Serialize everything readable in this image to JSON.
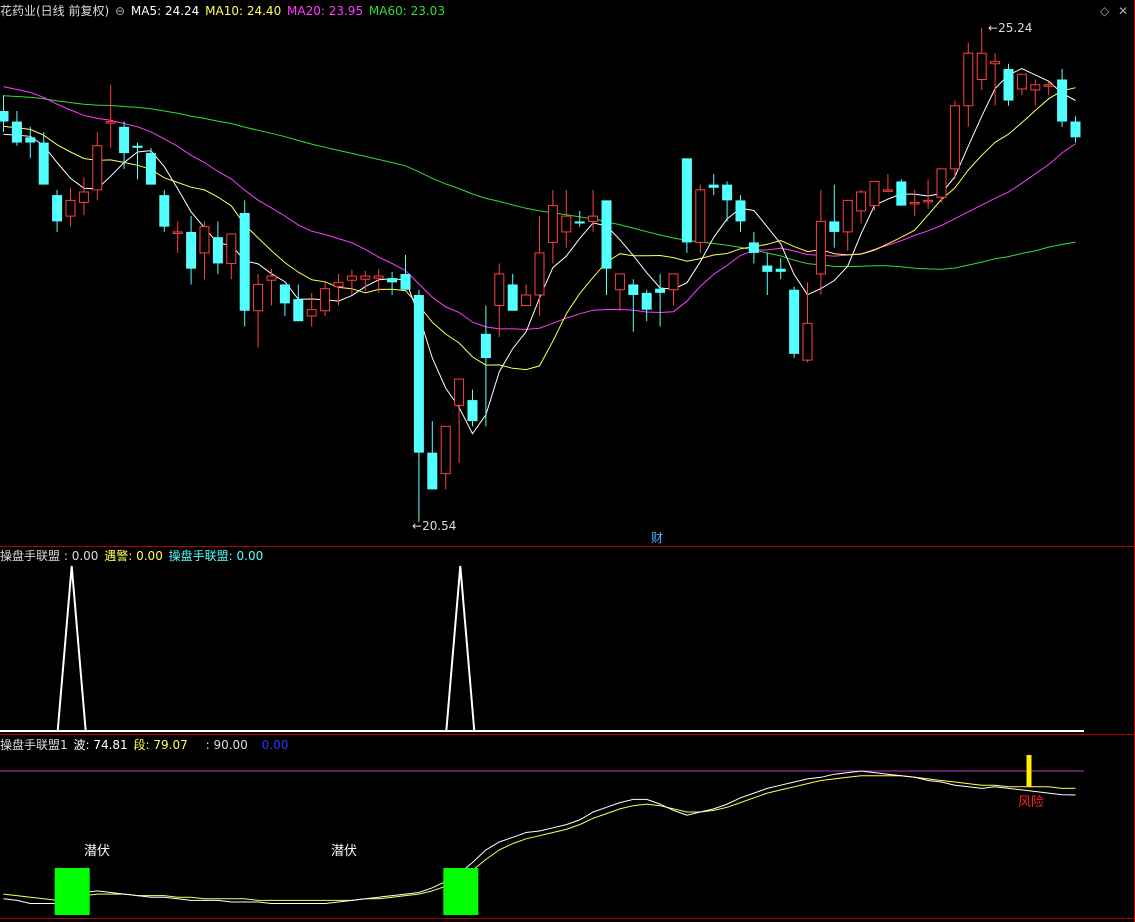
{
  "colors": {
    "up": "#ff4040",
    "down": "#54ffff",
    "ma5": "#ffffff",
    "ma10": "#ffff55",
    "ma20": "#ff3cff",
    "ma60": "#33dd33",
    "divider": "#b00000",
    "hline": "#c030c0",
    "green_box": "#00ff00",
    "yellow_bar": "#ffee00",
    "risk_text": "#ff2020"
  },
  "header": {
    "title": "花药业(日线 前复权)",
    "collapse_icon": "circle-minus-icon",
    "ma5": "MA5: 24.24",
    "ma10": "MA10: 24.40",
    "ma20": "MA20: 23.95",
    "ma60": "MA60: 23.03",
    "diamond_icon": "diamond-icon",
    "close_icon": "close-icon"
  },
  "indicator1": {
    "name1": "操盘手联盟",
    "val1": " : 0.00",
    "name2": "遇警",
    "val2": ": 0.00",
    "name3": "操盘手联盟",
    "val3": ": 0.00"
  },
  "indicator2": {
    "name": "操盘手联盟1",
    "bo_label": "波",
    "bo_val": ": 74.81",
    "duan_label": "段",
    "duan_val": ": 79.07",
    "line_val": ": 90.00",
    "blue_val": "0.00"
  },
  "annotations": {
    "high_price": "25.24",
    "low_price": "20.54",
    "cai_marker": "财",
    "ambush1": "潜伏",
    "ambush2": "潜伏",
    "risk": "风险"
  },
  "chart_data": [
    {
      "type": "candlestick",
      "title": "花药业(日线 前复权)",
      "ylim": [
        20.54,
        25.24
      ],
      "moving_averages": {
        "MA5": 24.24,
        "MA10": 24.4,
        "MA20": 23.95,
        "MA60": 23.03
      },
      "candles": [
        [
          24.45,
          24.6,
          24.25,
          24.35
        ],
        [
          24.35,
          24.45,
          24.12,
          24.15
        ],
        [
          24.2,
          24.3,
          24.0,
          24.15
        ],
        [
          24.15,
          24.25,
          23.8,
          23.75
        ],
        [
          23.65,
          23.7,
          23.3,
          23.4
        ],
        [
          23.45,
          23.72,
          23.35,
          23.6
        ],
        [
          23.58,
          23.82,
          23.46,
          23.68
        ],
        [
          23.7,
          24.25,
          23.6,
          24.12
        ],
        [
          24.35,
          24.7,
          24.1,
          24.35
        ],
        [
          24.3,
          24.35,
          23.9,
          24.05
        ],
        [
          24.12,
          24.15,
          23.8,
          24.1
        ],
        [
          24.05,
          24.1,
          23.85,
          23.75
        ],
        [
          23.65,
          23.7,
          23.3,
          23.35
        ],
        [
          23.3,
          23.4,
          23.1,
          23.3
        ],
        [
          23.3,
          23.45,
          22.8,
          22.95
        ],
        [
          23.1,
          23.4,
          22.85,
          23.35
        ],
        [
          23.25,
          23.4,
          22.9,
          23.0
        ],
        [
          23.0,
          23.2,
          22.85,
          23.28
        ],
        [
          23.48,
          23.6,
          22.4,
          22.55
        ],
        [
          22.55,
          22.9,
          22.2,
          22.8
        ],
        [
          22.84,
          22.95,
          22.6,
          22.88
        ],
        [
          22.8,
          22.8,
          22.5,
          22.62
        ],
        [
          22.66,
          22.8,
          22.45,
          22.45
        ],
        [
          22.5,
          22.72,
          22.4,
          22.56
        ],
        [
          22.55,
          22.82,
          22.5,
          22.76
        ],
        [
          22.78,
          22.9,
          22.6,
          22.82
        ],
        [
          22.84,
          22.94,
          22.7,
          22.88
        ],
        [
          22.85,
          22.93,
          22.74,
          22.88
        ],
        [
          22.86,
          22.95,
          22.72,
          22.88
        ],
        [
          22.86,
          22.92,
          22.7,
          22.82
        ],
        [
          22.9,
          23.08,
          22.75,
          22.75
        ],
        [
          22.7,
          22.75,
          20.54,
          21.2
        ],
        [
          21.2,
          21.5,
          20.85,
          20.85
        ],
        [
          21.0,
          21.4,
          20.85,
          21.45
        ],
        [
          21.65,
          21.8,
          21.1,
          21.9
        ],
        [
          21.7,
          21.8,
          21.45,
          21.5
        ],
        [
          22.33,
          22.6,
          21.45,
          22.1
        ],
        [
          22.6,
          23.0,
          22.3,
          22.9
        ],
        [
          22.8,
          22.9,
          22.55,
          22.55
        ],
        [
          22.6,
          22.8,
          22.6,
          22.7
        ],
        [
          22.7,
          23.45,
          22.5,
          23.1
        ],
        [
          23.2,
          23.7,
          23.0,
          23.55
        ],
        [
          23.3,
          23.7,
          23.15,
          23.45
        ],
        [
          23.4,
          23.5,
          23.35,
          23.38
        ],
        [
          23.4,
          23.7,
          23.3,
          23.45
        ],
        [
          23.6,
          23.6,
          22.7,
          22.95
        ],
        [
          22.75,
          22.85,
          22.55,
          22.9
        ],
        [
          22.8,
          22.85,
          22.35,
          22.7
        ],
        [
          22.72,
          22.75,
          22.45,
          22.56
        ],
        [
          22.76,
          22.9,
          22.4,
          22.72
        ],
        [
          22.75,
          22.8,
          22.6,
          22.9
        ],
        [
          24.0,
          24.0,
          23.1,
          23.2
        ],
        [
          23.2,
          23.75,
          23.1,
          23.7
        ],
        [
          23.75,
          23.85,
          23.65,
          23.72
        ],
        [
          23.75,
          23.78,
          23.4,
          23.6
        ],
        [
          23.6,
          23.65,
          23.3,
          23.4
        ],
        [
          23.2,
          23.3,
          23.0,
          23.1
        ],
        [
          22.98,
          23.1,
          22.7,
          22.92
        ],
        [
          22.95,
          23.05,
          22.85,
          22.92
        ],
        [
          22.75,
          22.78,
          22.1,
          22.14
        ],
        [
          22.08,
          22.82,
          22.06,
          22.43
        ],
        [
          22.9,
          23.7,
          22.7,
          23.4
        ],
        [
          23.4,
          23.75,
          23.15,
          23.3
        ],
        [
          23.3,
          23.6,
          23.12,
          23.6
        ],
        [
          23.5,
          23.7,
          23.38,
          23.68
        ],
        [
          23.55,
          23.7,
          23.5,
          23.78
        ],
        [
          23.7,
          23.85,
          23.68,
          23.7
        ],
        [
          23.78,
          23.8,
          23.55,
          23.55
        ],
        [
          23.58,
          23.7,
          23.45,
          23.58
        ],
        [
          23.6,
          23.8,
          23.52,
          23.6
        ],
        [
          23.63,
          23.9,
          23.58,
          23.9
        ],
        [
          23.9,
          24.55,
          23.8,
          24.5
        ],
        [
          24.5,
          25.1,
          24.3,
          25.0
        ],
        [
          24.75,
          25.24,
          24.65,
          25.0
        ],
        [
          24.9,
          25.0,
          24.5,
          24.92
        ],
        [
          24.85,
          24.9,
          24.5,
          24.55
        ],
        [
          24.66,
          24.8,
          24.6,
          24.8
        ],
        [
          24.65,
          24.75,
          24.5,
          24.7
        ],
        [
          24.7,
          24.73,
          24.6,
          24.7
        ],
        [
          24.75,
          24.85,
          24.3,
          24.35
        ],
        [
          24.35,
          24.4,
          24.15,
          24.2
        ]
      ]
    },
    {
      "type": "line",
      "title": "操盘手联盟",
      "series": [
        {
          "name": "操盘手联盟",
          "values": [
            0,
            0,
            0,
            1,
            0,
            0,
            0,
            0,
            0,
            0,
            0,
            0,
            0,
            0,
            0,
            0,
            0,
            0,
            0,
            0,
            0,
            0,
            0,
            0,
            0,
            0,
            0,
            0,
            0,
            0,
            0,
            0,
            1,
            0,
            0,
            0,
            0,
            0,
            0,
            0,
            0,
            0,
            0,
            0,
            0,
            0,
            0,
            0,
            0,
            0,
            0,
            0,
            0,
            0,
            0,
            0,
            0,
            0,
            0,
            0,
            0,
            0,
            0,
            0,
            0,
            0,
            0,
            0,
            0,
            0,
            0,
            0,
            0,
            0,
            0,
            0,
            0,
            0,
            0,
            0,
            0
          ]
        },
        {
          "name": "遇警",
          "values": [
            0,
            0,
            0,
            0,
            0,
            0,
            0,
            0,
            0,
            0,
            0,
            0,
            0,
            0,
            0,
            0,
            0,
            0,
            0,
            0,
            0,
            0,
            0,
            0,
            0,
            0,
            0,
            0,
            0,
            0,
            0,
            0,
            0,
            0,
            0,
            0,
            0,
            0,
            0,
            0,
            0,
            0,
            0,
            0,
            0,
            0,
            0,
            0,
            0,
            0,
            0,
            0,
            0,
            0,
            0,
            0,
            0,
            0,
            0,
            0,
            0,
            0,
            0,
            0,
            0,
            0,
            0,
            0,
            0,
            0,
            0,
            0,
            0,
            0,
            0,
            0,
            0,
            0,
            0,
            0,
            0
          ]
        }
      ]
    },
    {
      "type": "line",
      "title": "操盘手联盟1",
      "ylim": [
        0,
        100
      ],
      "hline": 90,
      "series": [
        {
          "name": "波",
          "values": [
            9,
            8,
            6,
            6,
            6,
            10,
            13,
            14,
            13,
            12,
            11,
            10,
            10,
            9,
            8,
            8,
            8,
            7,
            7,
            7,
            6,
            6,
            6,
            6,
            6,
            7,
            8,
            9,
            10,
            11,
            12,
            13,
            16,
            20,
            25,
            32,
            40,
            45,
            48,
            51,
            52,
            54,
            56,
            59,
            64,
            67,
            70,
            72,
            72,
            69,
            65,
            62,
            64,
            66,
            69,
            73,
            76,
            79,
            81,
            83,
            85,
            86,
            88,
            89,
            90,
            89,
            88,
            87,
            86,
            84,
            83,
            81,
            80,
            79,
            80,
            79,
            78,
            77,
            76,
            75,
            74.81
          ]
        },
        {
          "name": "段",
          "values": [
            12,
            11,
            10,
            9,
            8,
            10,
            11,
            12,
            12,
            12,
            11,
            11,
            11,
            10,
            10,
            9,
            9,
            9,
            9,
            8,
            8,
            8,
            8,
            8,
            8,
            8,
            8,
            9,
            9,
            10,
            11,
            12,
            14,
            17,
            21,
            27,
            34,
            40,
            44,
            47,
            49,
            51,
            53,
            56,
            60,
            63,
            66,
            68,
            69,
            68,
            66,
            64,
            64,
            65,
            67,
            70,
            73,
            76,
            78,
            80,
            82,
            84,
            85,
            86,
            87,
            87,
            87,
            87,
            86,
            85,
            84,
            83,
            82,
            81,
            81,
            80,
            80,
            80,
            80,
            79,
            79.07
          ]
        }
      ],
      "signals": [
        {
          "index": 3,
          "text": "潜伏"
        },
        {
          "index": 32,
          "text": "潜伏"
        },
        {
          "index": 75,
          "text": "风险"
        }
      ]
    }
  ]
}
